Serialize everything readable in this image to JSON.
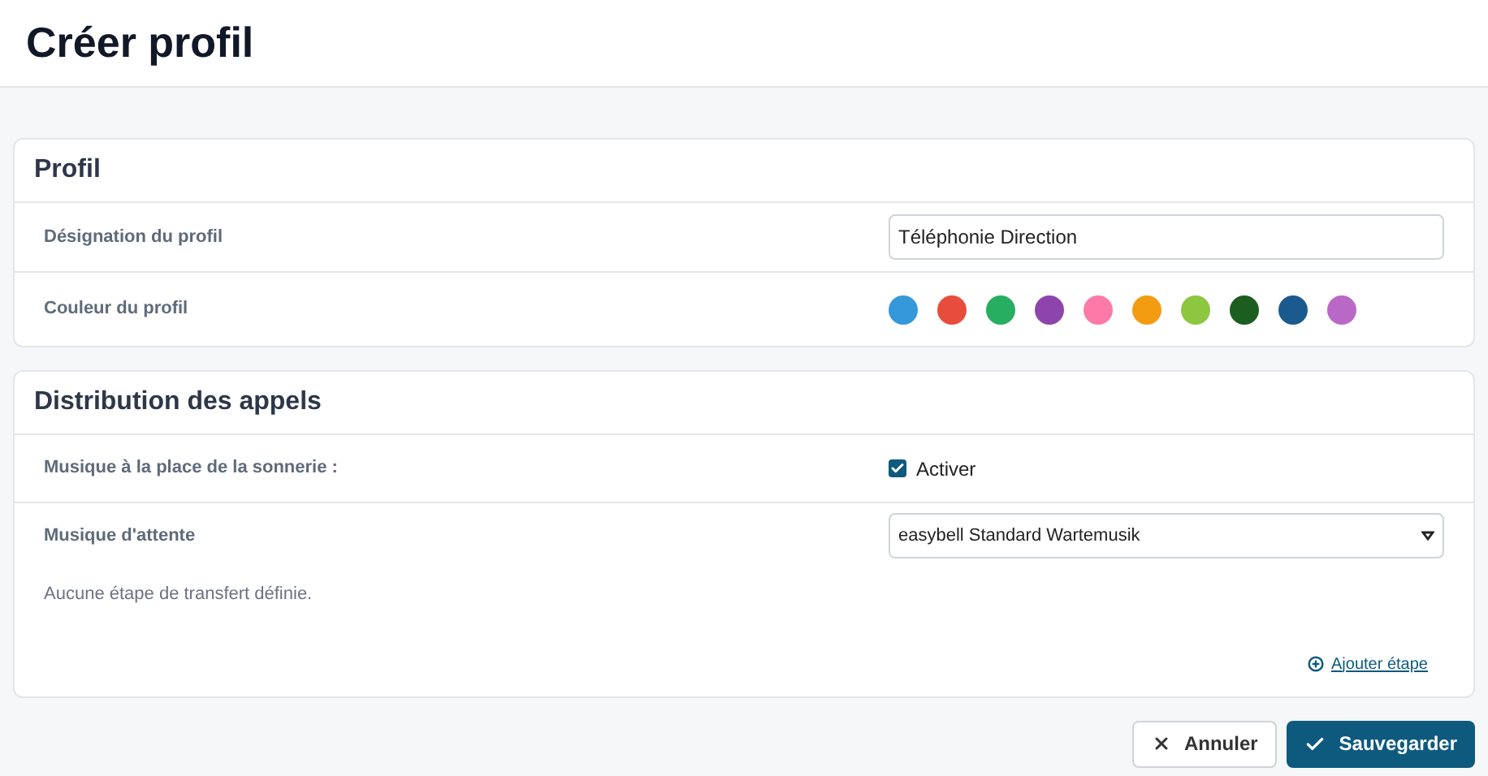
{
  "page_title": "Créer profil",
  "profile": {
    "title": "Profil",
    "name_label": "Désignation du profil",
    "name_value": "Téléphonie Direction",
    "color_label": "Couleur du profil",
    "colors": [
      {
        "color": "#3498db",
        "selected": false
      },
      {
        "color": "#e74c3c",
        "selected": false
      },
      {
        "color": "#27ae60",
        "selected": false
      },
      {
        "color": "#8e44ad",
        "selected": false
      },
      {
        "color": "#fd79a8",
        "selected": false
      },
      {
        "color": "#f39c12",
        "selected": false
      },
      {
        "color": "#8dc63f",
        "selected": false
      },
      {
        "color": "#1b5e20",
        "selected": false
      },
      {
        "color": "#1a5a8e",
        "selected": false
      },
      {
        "color": "#ba68c8",
        "selected": false
      }
    ]
  },
  "distribution": {
    "title": "Distribution des appels",
    "music_label": "Musique à la place de la sonnerie :",
    "music_checkbox": {
      "label": "Activer",
      "checked": true
    },
    "hold_label": "Musique d'attente",
    "hold_value": "easybell Standard Wartemusik",
    "empty_note": "Aucune étape de transfert définie.",
    "add_link": "Ajouter étape"
  },
  "buttons": {
    "cancel": "Annuler",
    "save": "Sauvegarder"
  }
}
